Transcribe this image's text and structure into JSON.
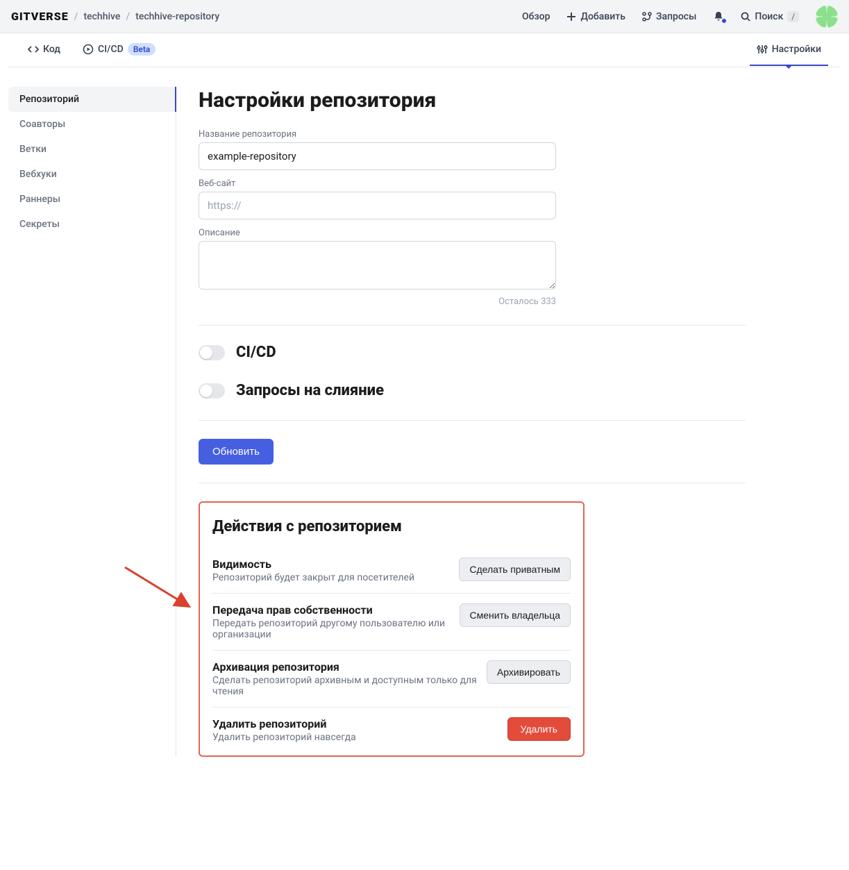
{
  "header": {
    "logo": "GITVERSE",
    "breadcrumb": {
      "owner": "techhive",
      "repo": "techhive-repository"
    },
    "nav": {
      "overview": "Обзор",
      "add": "Добавить",
      "requests": "Запросы",
      "search": "Поиск",
      "search_kbd": "/"
    }
  },
  "tabs": {
    "code": "Код",
    "cicd": "CI/CD",
    "cicd_badge": "Beta",
    "settings": "Настройки"
  },
  "sidebar": {
    "items": [
      {
        "label": "Репозиторий"
      },
      {
        "label": "Соавторы"
      },
      {
        "label": "Ветки"
      },
      {
        "label": "Вебхуки"
      },
      {
        "label": "Раннеры"
      },
      {
        "label": "Секреты"
      }
    ]
  },
  "page": {
    "title": "Настройки репозитория",
    "name_label": "Название репозитория",
    "name_value": "example-repository",
    "website_label": "Веб-сайт",
    "website_placeholder": "https://",
    "desc_label": "Описание",
    "desc_counter": "Осталось 333",
    "toggle_cicd": "CI/CD",
    "toggle_merge": "Запросы на слияние",
    "update_btn": "Обновить"
  },
  "danger": {
    "title": "Действия с репозиторием",
    "visibility": {
      "title": "Видимость",
      "desc": "Репозиторий будет закрыт для посетителей",
      "btn": "Сделать приватным"
    },
    "transfer": {
      "title": "Передача прав собственности",
      "desc": "Передать репозиторий другому пользователю или организации",
      "btn": "Сменить владельца"
    },
    "archive": {
      "title": "Архивация репозитория",
      "desc": "Сделать репозиторий архивным и доступным только для чтения",
      "btn": "Архивировать"
    },
    "delete": {
      "title": "Удалить репозиторий",
      "desc": "Удалить репозиторий навсегда",
      "btn": "Удалить"
    }
  }
}
